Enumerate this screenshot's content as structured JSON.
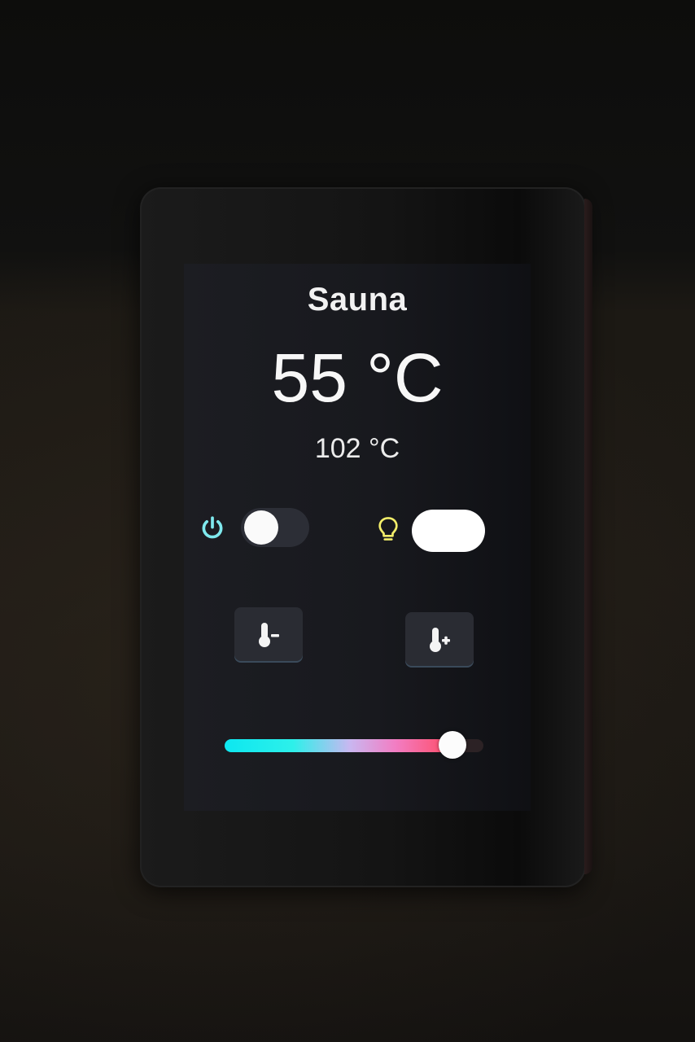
{
  "screen": {
    "title": "Sauna",
    "current_temperature": "55 °C",
    "target_temperature": "102 °C"
  },
  "controls": {
    "power": {
      "icon": "power-icon",
      "state": "off",
      "color": "#7fe9ee"
    },
    "light": {
      "icon": "lightbulb-icon",
      "state": "on",
      "color": "#f3ee6a"
    },
    "temp_decrease": {
      "icon": "thermometer-minus-icon"
    },
    "temp_increase": {
      "icon": "thermometer-plus-icon"
    },
    "color_slider": {
      "value": 0.88,
      "gradient": [
        "#0de7f0",
        "#c9b7f0",
        "#f27dc3",
        "#ff4a63"
      ]
    }
  }
}
